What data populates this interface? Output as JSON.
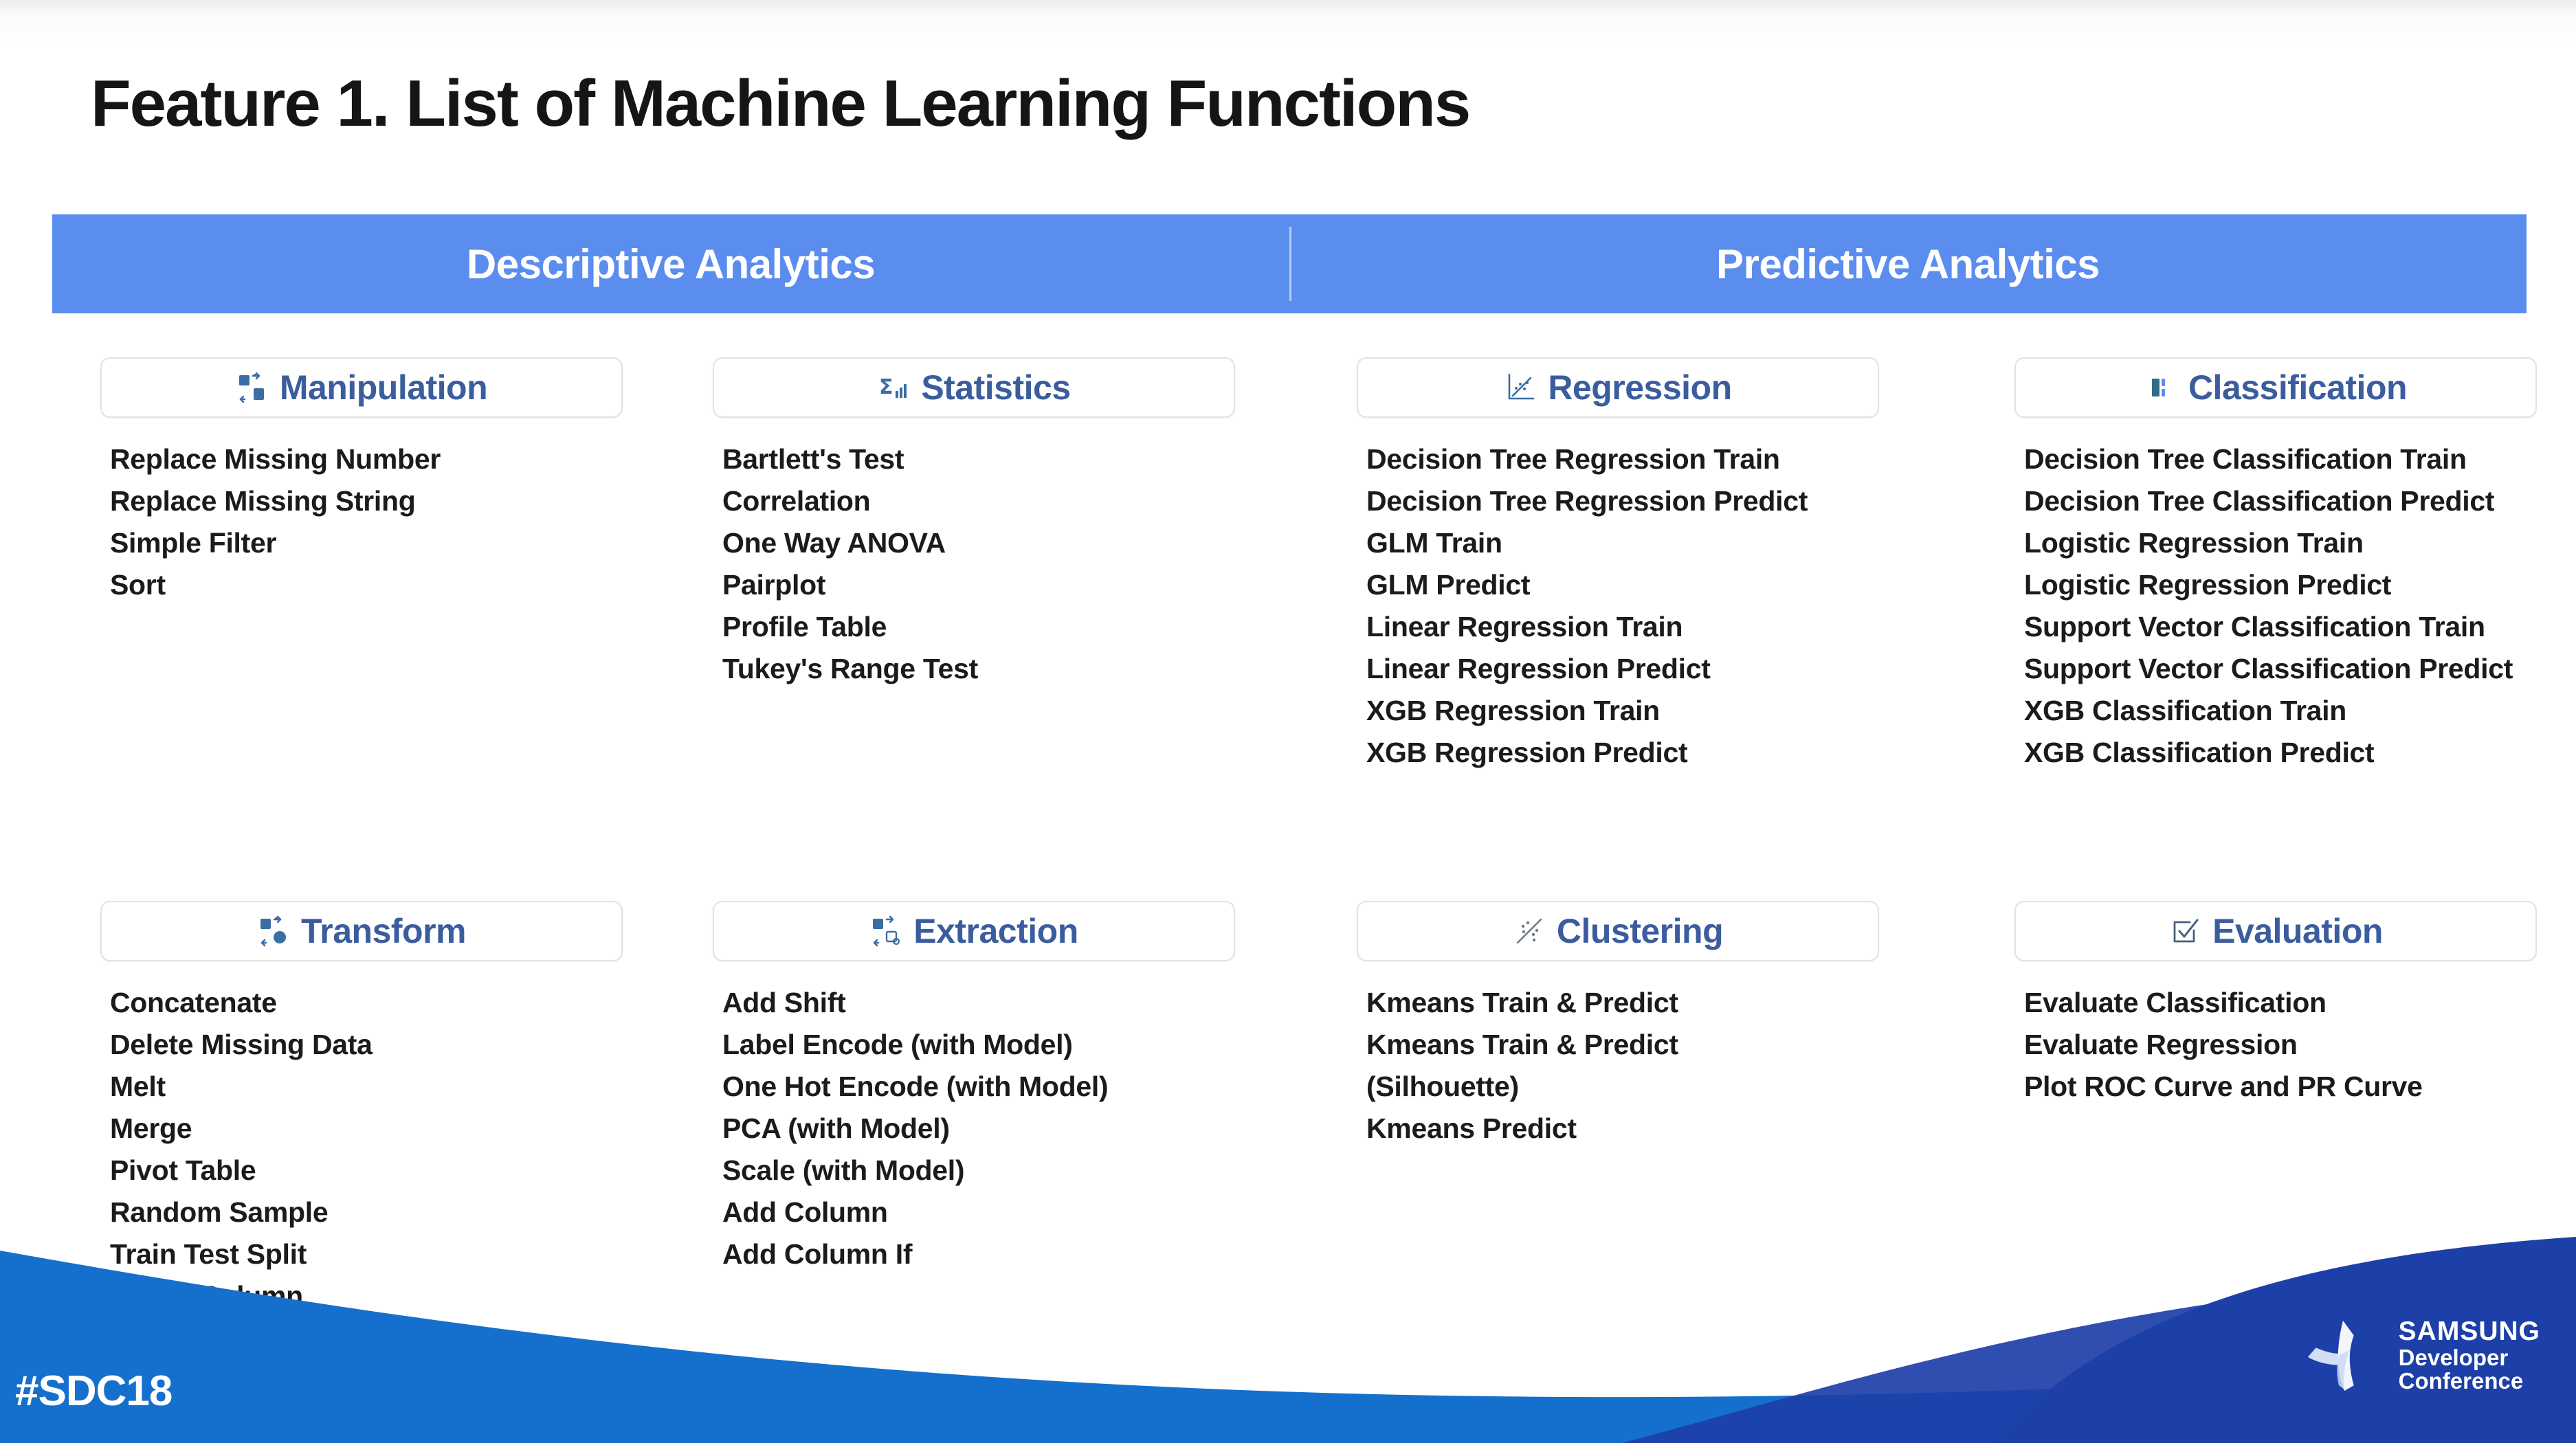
{
  "slide": {
    "title": "Feature 1. List of Machine Learning Functions"
  },
  "banner": {
    "left_label": "Descriptive Analytics",
    "right_label": "Predictive Analytics",
    "color": "#5b8def"
  },
  "theme": {
    "pill_text_color": "#3b5d9e",
    "pill_border_color": "#dfe2e6",
    "item_text_color": "#1b1b1b",
    "footer_blue": "#1470cc",
    "footer_deep_blue": "#1d3fa8"
  },
  "categories": [
    {
      "id": "manipulation",
      "label": "Manipulation",
      "icon": "shuffle-blocks-icon",
      "items": [
        "Replace Missing Number",
        "Replace Missing String",
        "Simple Filter",
        "Sort"
      ]
    },
    {
      "id": "statistics",
      "label": "Statistics",
      "icon": "sigma-bars-icon",
      "items": [
        "Bartlett's Test",
        "Correlation",
        "One Way ANOVA",
        "Pairplot",
        "Profile Table",
        "Tukey's Range Test"
      ]
    },
    {
      "id": "regression",
      "label": "Regression",
      "icon": "scatter-trendline-icon",
      "items": [
        "Decision Tree Regression Train",
        "Decision Tree Regression Predict",
        "GLM Train",
        "GLM Predict",
        "Linear Regression Train",
        "Linear Regression Predict",
        "XGB Regression Train",
        "XGB Regression Predict"
      ]
    },
    {
      "id": "classification",
      "label": "Classification",
      "icon": "bar-columns-icon",
      "items": [
        "Decision Tree Classification Train",
        "Decision Tree Classification Predict",
        "Logistic Regression Train",
        "Logistic Regression Predict",
        "Support Vector Classification Train",
        "Support Vector Classification Predict",
        "XGB Classification Train",
        "XGB Classification Predict"
      ]
    },
    {
      "id": "transform",
      "label": "Transform",
      "icon": "shuffle-blocks-icon",
      "items": [
        "Concatenate",
        "Delete Missing Data",
        "Melt",
        "Merge",
        "Pivot Table",
        "Random Sample",
        "Train Test Split",
        "Select Column"
      ]
    },
    {
      "id": "extraction",
      "label": "Extraction",
      "icon": "extract-blocks-icon",
      "items": [
        "Add Shift",
        "Label Encode (with Model)",
        "One Hot Encode (with Model)",
        "PCA (with Model)",
        "Scale (with Model)",
        "Add Column",
        "Add Column If"
      ]
    },
    {
      "id": "clustering",
      "label": "Clustering",
      "icon": "scatter-cluster-icon",
      "items": [
        "Kmeans Train & Predict",
        "Kmeans Train & Predict",
        "(Silhouette)",
        "Kmeans Predict"
      ]
    },
    {
      "id": "evaluation",
      "label": "Evaluation",
      "icon": "checkbox-check-icon",
      "items": [
        "Evaluate Classification",
        "Evaluate Regression",
        "Plot ROC Curve and PR Curve"
      ]
    }
  ],
  "footer": {
    "hashtag": "#SDC18",
    "logo_line1": "SAMSUNG",
    "logo_line2": "Developer",
    "logo_line3": "Conference"
  }
}
